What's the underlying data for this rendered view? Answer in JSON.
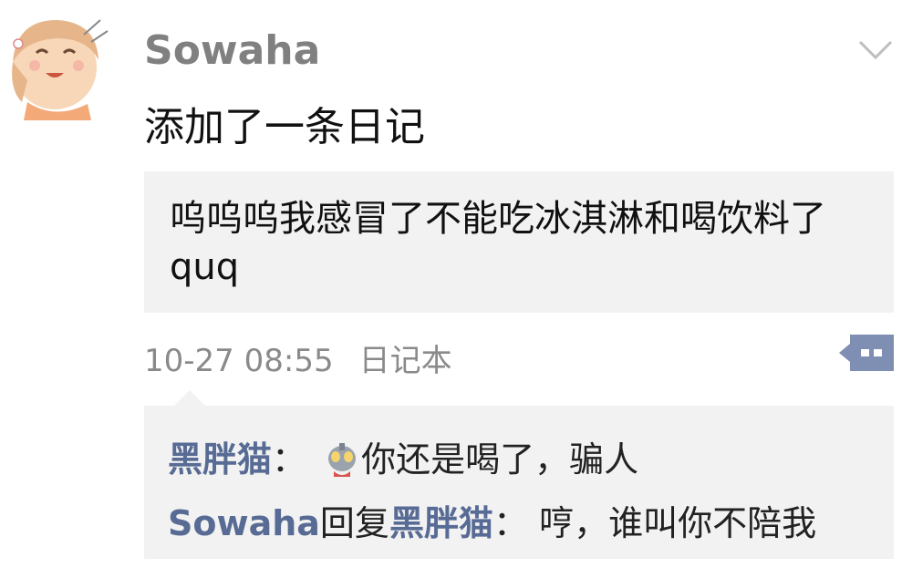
{
  "post": {
    "author": "Sowaha",
    "action": "添加了一条日记",
    "content": "呜呜呜我感冒了不能吃冰淇淋和喝饮料了quq",
    "timestamp": "10-27 08:55",
    "source": "日记本"
  },
  "icons": {
    "avatar": "anime-girl-avatar",
    "expand": "chevron-down-icon",
    "more": "comment-more-icon",
    "emoji": "robot-emoji-icon"
  },
  "comments": [
    {
      "user": "黑胖猫",
      "separator": "：",
      "text": "你还是喝了，骗人"
    },
    {
      "user": "Sowaha",
      "reply_word": "回复",
      "reply_to": "黑胖猫",
      "separator": "：",
      "text": "哼，谁叫你不陪我"
    }
  ],
  "colors": {
    "username": "#576b95",
    "box_bg": "#f2f2f2",
    "author": "#808080",
    "more_button": "#7f8fb3"
  }
}
